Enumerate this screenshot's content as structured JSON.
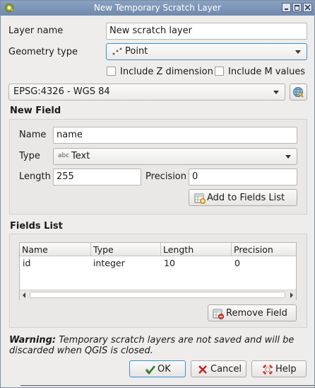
{
  "window": {
    "title": "New Temporary Scratch Layer"
  },
  "form": {
    "layer_name_label": "Layer name",
    "layer_name_value": "New scratch layer",
    "geometry_type_label": "Geometry type",
    "geometry_type_value": "Point",
    "include_z_label": "Include Z dimension",
    "include_m_label": "Include M values",
    "include_z_checked": false,
    "include_m_checked": false,
    "crs_value": "EPSG:4326 - WGS 84"
  },
  "new_field": {
    "section_title": "New Field",
    "name_label": "Name",
    "name_value": "name",
    "type_label": "Type",
    "type_icon_text": "abc",
    "type_value": "Text",
    "length_label": "Length",
    "length_value": "255",
    "precision_label": "Precision",
    "precision_value": "0",
    "add_button_label": "Add to Fields List"
  },
  "fields_list": {
    "section_title": "Fields List",
    "columns": [
      "Name",
      "Type",
      "Length",
      "Precision"
    ],
    "rows": [
      {
        "name": "id",
        "type": "integer",
        "length": "10",
        "precision": "0"
      }
    ],
    "remove_button_label": "Remove Field"
  },
  "warning": {
    "bold": "Warning:",
    "text": " Temporary scratch layers are not saved and will be discarded when QGIS is closed."
  },
  "buttons": {
    "ok": "OK",
    "cancel": "Cancel",
    "help": "Help"
  },
  "colors": {
    "titlebar": "#7b93b5",
    "focus_border": "#3d8ec9",
    "dialog_bg": "#eeedec"
  }
}
